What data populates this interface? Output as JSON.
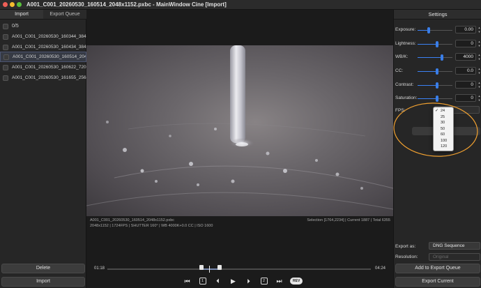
{
  "window": {
    "title": "A001_C001_20260530_160514_2048x1152.pxbc - MainWindow Cine [Import]"
  },
  "left_panel": {
    "tabs": [
      "Import",
      "Export Queue"
    ],
    "selection_count": "0/5",
    "clips": [
      {
        "name": "A001_C001_20260530_160344_384...",
        "selected": false
      },
      {
        "name": "A001_C001_20260530_160434_384...",
        "selected": false
      },
      {
        "name": "A001_C001_20260530_160514_204...",
        "selected": true
      },
      {
        "name": "A001_C001_20260530_160622_720...",
        "selected": false
      },
      {
        "name": "A001_C001_20260530_161655_256...",
        "selected": false
      }
    ],
    "delete_label": "Delete",
    "import_label": "Import"
  },
  "viewer": {
    "filename": "A001_C001_20260530_160514_2048x1152.pxbc",
    "meta": "2048x1152 | 1724FPS | SHUTTER 160° | WB 4000K+0.0 CC | ISO 1600",
    "frame_info": "Selection [1764,2234] | Current 1887 | Total 6355",
    "time_start": "01:18",
    "time_end": "04:24",
    "controls": {
      "mark1": "1",
      "mark2": "2",
      "rev": "REV"
    }
  },
  "settings": {
    "title": "Settings",
    "sliders": [
      {
        "label": "Exposure:",
        "value": "0.00",
        "fraction": 0.32
      },
      {
        "label": "Lightness:",
        "value": "0",
        "fraction": 0.55
      },
      {
        "label": "WB/K:",
        "value": "4000",
        "fraction": 0.7
      },
      {
        "label": "CC:",
        "value": "0.0",
        "fraction": 0.55
      },
      {
        "label": "Contrast:",
        "value": "0",
        "fraction": 0.55
      },
      {
        "label": "Saturation:",
        "value": "0",
        "fraction": 0.55
      }
    ],
    "fps_label": "FPS:",
    "fps_options": [
      "24",
      "25",
      "30",
      "50",
      "60",
      "100",
      "120"
    ],
    "fps_selected": "24",
    "export_as_label": "Export as:",
    "export_as_value": "DNG Sequence",
    "resolution_label": "Resolution:",
    "resolution_value": "Original",
    "add_queue_label": "Add to Export Queue",
    "export_current_label": "Export Current"
  },
  "colors": {
    "annotation": "#f0a030",
    "accent": "#3b82f6"
  }
}
